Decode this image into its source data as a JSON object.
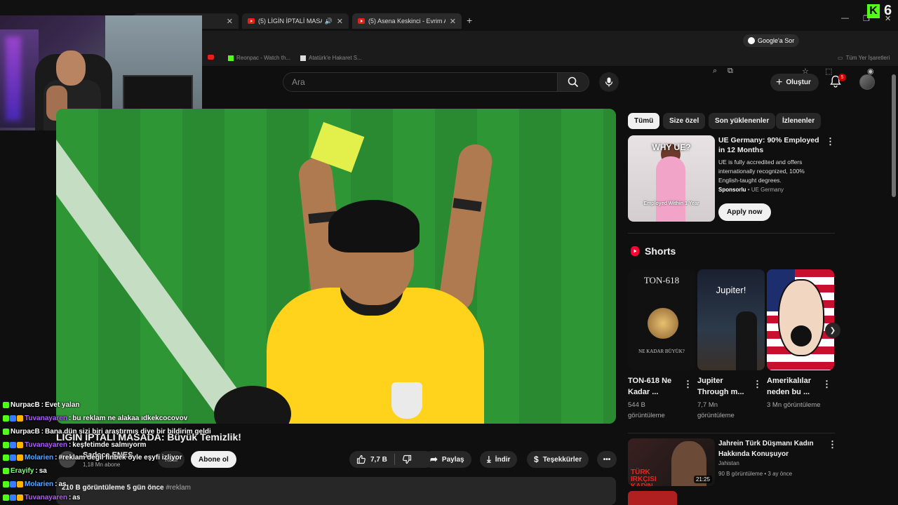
{
  "browser": {
    "tabs": [
      {
        "label": "(5) LİGİN İPTALİ MASADA: B",
        "audio": true
      },
      {
        "label": "(5) Asena Keskinci - Evrim Akın",
        "audio": false
      }
    ],
    "google_button": "Google'a Sor",
    "bookmarks": [
      "Reonpac - Watch th...",
      "Atatürk'e Hakaret S..."
    ],
    "bookmarks_folder": "Tüm Yer İşaretleri"
  },
  "overlay": {
    "kick_count": "6"
  },
  "youtube": {
    "search_placeholder": "Ara",
    "create_label": "Oluştur",
    "notification_count": "5"
  },
  "video": {
    "title": "LİGİN İPTALİ MASADA: Büyük Temizlik!",
    "channel_name": "Sadece ENES",
    "subscribers": "1,18 Mn abone",
    "join_label": "Katıl",
    "subscribe_label": "Abone ol",
    "likes": "7,7 B",
    "share_label": "Paylaş",
    "download_label": "İndir",
    "thanks_label": "Teşekkürler",
    "views_date": "210 B görüntüleme  5 gün önce",
    "hashtag": "#reklam"
  },
  "chat": [
    {
      "user": "NurpacB",
      "user_color": "#ffffff",
      "message": "Evet yalan"
    },
    {
      "user": "Tuvanayaren",
      "user_color": "#b05cff",
      "message": "bu reklam ne alakaa ıdkekcocovov"
    },
    {
      "user": "NurpacB",
      "user_color": "#ffffff",
      "message": "Bana dün sizi biri araştırmış diye bir bildirim geldi"
    },
    {
      "user": "Tuvanayaren",
      "user_color": "#b05cff",
      "message": "keşfetimde salmıyorm"
    },
    {
      "user": "Molarien",
      "user_color": "#5aa9ff",
      "message": "#reklam değil finbek öyle eşyfi izliyor"
    },
    {
      "user": "Erayify",
      "user_color": "#7cff7c",
      "message": "sa"
    },
    {
      "user": "Molarien",
      "user_color": "#5aa9ff",
      "message": "as"
    },
    {
      "user": "Tuvanayaren",
      "user_color": "#b05cff",
      "message": "as"
    }
  ],
  "sidebar": {
    "chips": [
      "Tümü",
      "Size özel",
      "Son yüklenenler",
      "İzlenenler"
    ],
    "ad": {
      "thumb_headline": "WHY UE?",
      "thumb_caption": "Employed Within 1 Year",
      "title": "UE Germany: 90% Employed in 12 Months",
      "description": "UE is fully accredited and offers internationally recognized, 100% English-taught degrees.",
      "sponsored": "Sponsorlu",
      "advertiser": "UE Germany",
      "cta": "Apply now"
    },
    "shorts_heading": "Shorts",
    "shorts": [
      {
        "thumb_text": "TON-618",
        "thumb_sub": "NE KADAR BÜYÜK?",
        "title": "TON-618 Ne Kadar ...",
        "views": "544 B görüntüleme"
      },
      {
        "thumb_text": "Jupiter!",
        "thumb_sub": "",
        "title": "Jupiter Through m...",
        "views": "7,7 Mn görüntüleme"
      },
      {
        "thumb_text": "",
        "thumb_sub": "",
        "title": "Amerikalılar neden bu ...",
        "views": "3 Mn görüntüleme"
      }
    ],
    "recommended": {
      "thumb_text": "TÜRK IRKÇISI KADIN",
      "duration": "21:25",
      "title": "Jahrein Türk Düşmanı Kadın Hakkında Konuşuyor",
      "channel": "Jahistan",
      "meta": "90 B görüntüleme • 3 ay önce"
    }
  }
}
